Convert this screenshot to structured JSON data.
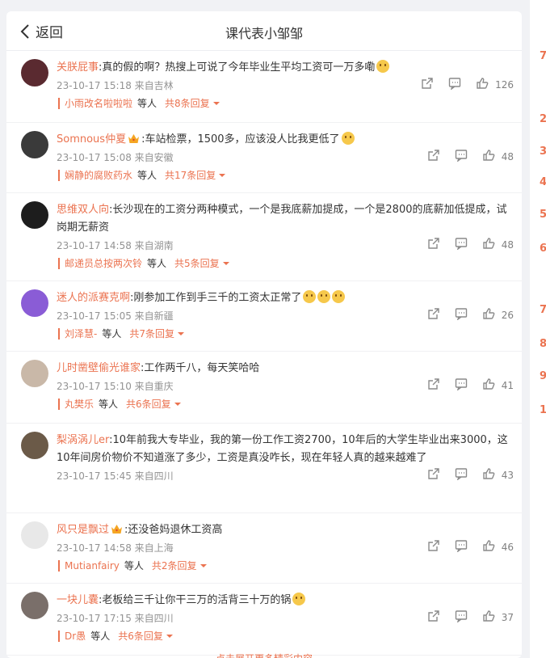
{
  "header": {
    "back_label": "返回",
    "title": "课代表小邹邹"
  },
  "comments": [
    {
      "user": "关朕屁事",
      "crown": false,
      "text": ":真的假的啊？热搜上可说了今年毕业生平均工资可一万多嘞",
      "emojis": 1,
      "time": "23-10-17 15:18 来自吉林",
      "likes": "126",
      "reply_user": "小雨改名啦啦啦",
      "reply_mid": "等人",
      "reply_count": "共8条回复",
      "avatar_color": "#5a2a30"
    },
    {
      "user": "Somnous仲夏",
      "crown": true,
      "text": ":车站检票，1500多，应该没人比我更低了",
      "emojis": 1,
      "time": "23-10-17 15:08 来自安徽",
      "likes": "48",
      "reply_user": "娴静的腐败药水",
      "reply_mid": "等人",
      "reply_count": "共17条回复",
      "avatar_color": "#3a3a3a"
    },
    {
      "user": "思维双人向",
      "crown": false,
      "text": ":长沙现在的工资分两种模式，一个是我底薪加提成，一个是2800的底薪加低提成，试岗期无薪资",
      "emojis": 0,
      "time": "23-10-17 14:58 来自湖南",
      "likes": "48",
      "reply_user": "邮递员总按两次铃",
      "reply_mid": "等人",
      "reply_count": "共5条回复",
      "avatar_color": "#1d1d1d"
    },
    {
      "user": "迷人的派赛克啊",
      "crown": false,
      "text": ":刚参加工作到手三千的工资太正常了",
      "emojis": 3,
      "time": "23-10-17 15:05 来自新疆",
      "likes": "26",
      "reply_user": "刘泽慧-",
      "reply_mid": "等人",
      "reply_count": "共7条回复",
      "avatar_color": "#8a5cd6"
    },
    {
      "user": "儿时凿壁偷光谁家",
      "crown": false,
      "text": ":工作两千八，每天笑哈哈",
      "emojis": 0,
      "time": "23-10-17 15:10 来自重庆",
      "likes": "41",
      "reply_user": "丸樊乐",
      "reply_mid": "等人",
      "reply_count": "共6条回复",
      "avatar_color": "#c9b8a8"
    },
    {
      "user": "梨涡涡儿er",
      "crown": false,
      "text": ":10年前我大专毕业，我的第一份工作工资2700，10年后的大学生毕业出来3000，这10年间房价物价不知道涨了多少，工资是真没咋长，现在年轻人真的越来越难了",
      "emojis": 0,
      "time": "23-10-17 15:45 来自四川",
      "likes": "43",
      "reply_user": "",
      "reply_mid": "",
      "reply_count": "",
      "avatar_color": "#6b5a48"
    },
    {
      "user": "风只是飘过",
      "crown": true,
      "text": ":还没爸妈退休工资高",
      "emojis": 0,
      "time": "23-10-17 14:58 来自上海",
      "likes": "46",
      "reply_user": "Mutianfairy",
      "reply_mid": "等人",
      "reply_count": "共2条回复",
      "avatar_color": "#e8e8e8"
    },
    {
      "user": "一块儿囊",
      "crown": false,
      "text": ":老板给三千让你干三万的活背三十万的锅",
      "emojis": 1,
      "time": "23-10-17 17:15 来自四川",
      "likes": "37",
      "reply_user": "Dr愚",
      "reply_mid": "等人",
      "reply_count": "共6条回复",
      "avatar_color": "#7a6f6a"
    }
  ],
  "footer": {
    "more_text": "点击展开更多精彩内容"
  },
  "right_panel": {
    "digits": [
      "7",
      "2",
      "3",
      "4",
      "5",
      "6",
      "7",
      "8",
      "9",
      "1"
    ]
  }
}
